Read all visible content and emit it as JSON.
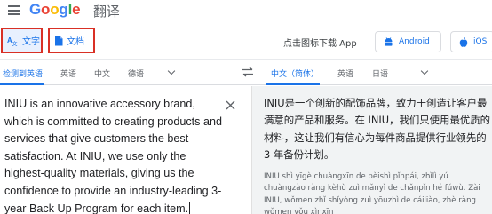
{
  "header": {
    "logo_letters": [
      {
        "ch": "G",
        "color": "#4285f4"
      },
      {
        "ch": "o",
        "color": "#ea4335"
      },
      {
        "ch": "o",
        "color": "#fbbc05"
      },
      {
        "ch": "g",
        "color": "#4285f4"
      },
      {
        "ch": "l",
        "color": "#34a853"
      },
      {
        "ch": "e",
        "color": "#ea4335"
      }
    ],
    "translate_word": "翻译"
  },
  "modes": {
    "text_label": "文字",
    "docs_label": "文档",
    "download_label": "点击图标下载 App",
    "android_label": "Android",
    "ios_label": "iOS"
  },
  "source_langs": {
    "detected": "检测到英语",
    "items": [
      "英语",
      "中文",
      "德语"
    ]
  },
  "target_langs": {
    "selected": "中文（简体）",
    "items": [
      "英语",
      "日语"
    ]
  },
  "source": {
    "text": "INIU is an innovative accessory brand, which is committed to creating products and services that give customers the best satisfaction. At INIU, we use only the highest-quality materials, giving us the confidence to provide an industry-leading 3-year Back Up Program for each item."
  },
  "target": {
    "text": "INIU是一个创新的配饰品牌，致力于创造让客户最满意的产品和服务。在 INIU，我们只使用最优质的材料，这让我们有信心为每件商品提供行业领先的 3 年备份计划。",
    "pinyin": "INIU shì yīgè chuàngxīn de pèishì pǐnpái, zhìlì yú chuàngzào ràng kèhù zuì mǎnyì de chǎnpǐn hé fúwù. Zài INIU, wǒmen zhǐ shǐyòng zuì yōuzhì de cáiliào, zhè ràng wǒmen yǒu xìnxīn"
  },
  "colors": {
    "accent_blue": "#1a73e8",
    "highlight_red": "#d93025",
    "target_bg": "#f1f3f4"
  },
  "icons": [
    "menu-icon",
    "text-icon",
    "document-icon",
    "android-icon",
    "apple-icon",
    "swap-icon",
    "close-icon",
    "chevron-down-icon"
  ]
}
